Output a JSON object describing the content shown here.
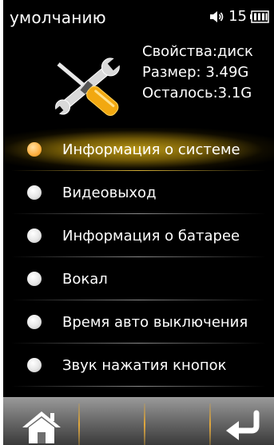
{
  "status_bar": {
    "title": "умолчанию",
    "volume_icon": "volume-icon",
    "volume_value": "15",
    "battery_icon": "battery-icon"
  },
  "storage_info": {
    "icon": "tools-icon",
    "property": "Свойства:диск",
    "size": "Размер: 3.49G",
    "remaining": "Осталось:3.1G"
  },
  "menu": {
    "items": [
      {
        "label": "Информация о системе",
        "selected": true
      },
      {
        "label": "Видеовыход",
        "selected": false
      },
      {
        "label": "Информация о батарее",
        "selected": false
      },
      {
        "label": "Вокал",
        "selected": false
      },
      {
        "label": "Время авто выключения",
        "selected": false
      },
      {
        "label": "Звук нажатия кнопок",
        "selected": false
      }
    ]
  },
  "bottom_bar": {
    "home_icon": "home-icon",
    "back_icon": "back-arrow-icon"
  },
  "colors": {
    "background": "#000000",
    "highlight": "#c4a018",
    "radio_selected": "#ffb347",
    "radio_default": "#e6e6e6"
  }
}
